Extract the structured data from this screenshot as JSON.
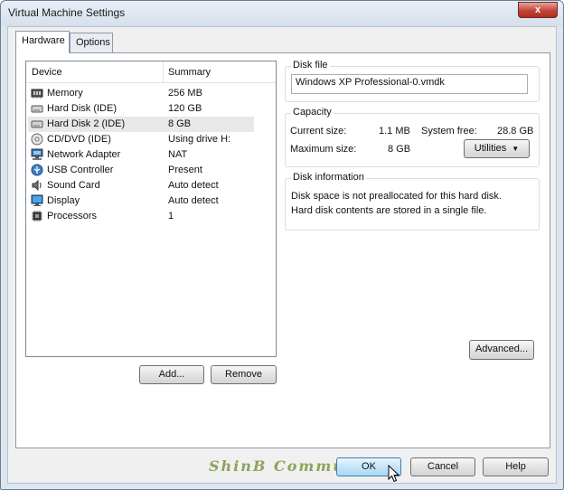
{
  "window": {
    "title": "Virtual Machine Settings",
    "close_glyph": "x"
  },
  "tabs": [
    {
      "label": "Hardware"
    },
    {
      "label": "Options"
    }
  ],
  "device_list": {
    "headers": {
      "device": "Device",
      "summary": "Summary"
    },
    "rows": [
      {
        "device": "Memory",
        "summary": "256 MB",
        "icon": "memory-icon"
      },
      {
        "device": "Hard Disk (IDE)",
        "summary": "120 GB",
        "icon": "hard-disk-icon"
      },
      {
        "device": "Hard Disk 2 (IDE)",
        "summary": "8 GB",
        "icon": "hard-disk-icon",
        "selected": true
      },
      {
        "device": "CD/DVD (IDE)",
        "summary": "Using drive H:",
        "icon": "cd-dvd-icon"
      },
      {
        "device": "Network Adapter",
        "summary": "NAT",
        "icon": "network-adapter-icon"
      },
      {
        "device": "USB Controller",
        "summary": "Present",
        "icon": "usb-controller-icon"
      },
      {
        "device": "Sound Card",
        "summary": "Auto detect",
        "icon": "sound-card-icon"
      },
      {
        "device": "Display",
        "summary": "Auto detect",
        "icon": "display-icon"
      },
      {
        "device": "Processors",
        "summary": "1",
        "icon": "processor-icon"
      }
    ]
  },
  "list_buttons": {
    "add": "Add...",
    "remove": "Remove"
  },
  "disk_file": {
    "label": "Disk file",
    "value": "Windows XP Professional-0.vmdk"
  },
  "capacity": {
    "label": "Capacity",
    "current_size_label": "Current size:",
    "current_size_value": "1.1 MB",
    "system_free_label": "System free:",
    "system_free_value": "28.8 GB",
    "max_size_label": "Maximum size:",
    "max_size_value": "8 GB",
    "utilities_label": "Utilities"
  },
  "disk_information": {
    "label": "Disk information",
    "line1": "Disk space is not preallocated for this hard disk.",
    "line2": "Hard disk contents are stored in a single file."
  },
  "advanced_label": "Advanced...",
  "watermark": "ShinB Community",
  "footer_buttons": {
    "ok": "OK",
    "cancel": "Cancel",
    "help": "Help"
  },
  "colors": {
    "title_bar": "#d6e0eb",
    "close_button": "#c2443a",
    "focus_button": "#a9d9f3",
    "selected_row": "#e8e8e8"
  }
}
